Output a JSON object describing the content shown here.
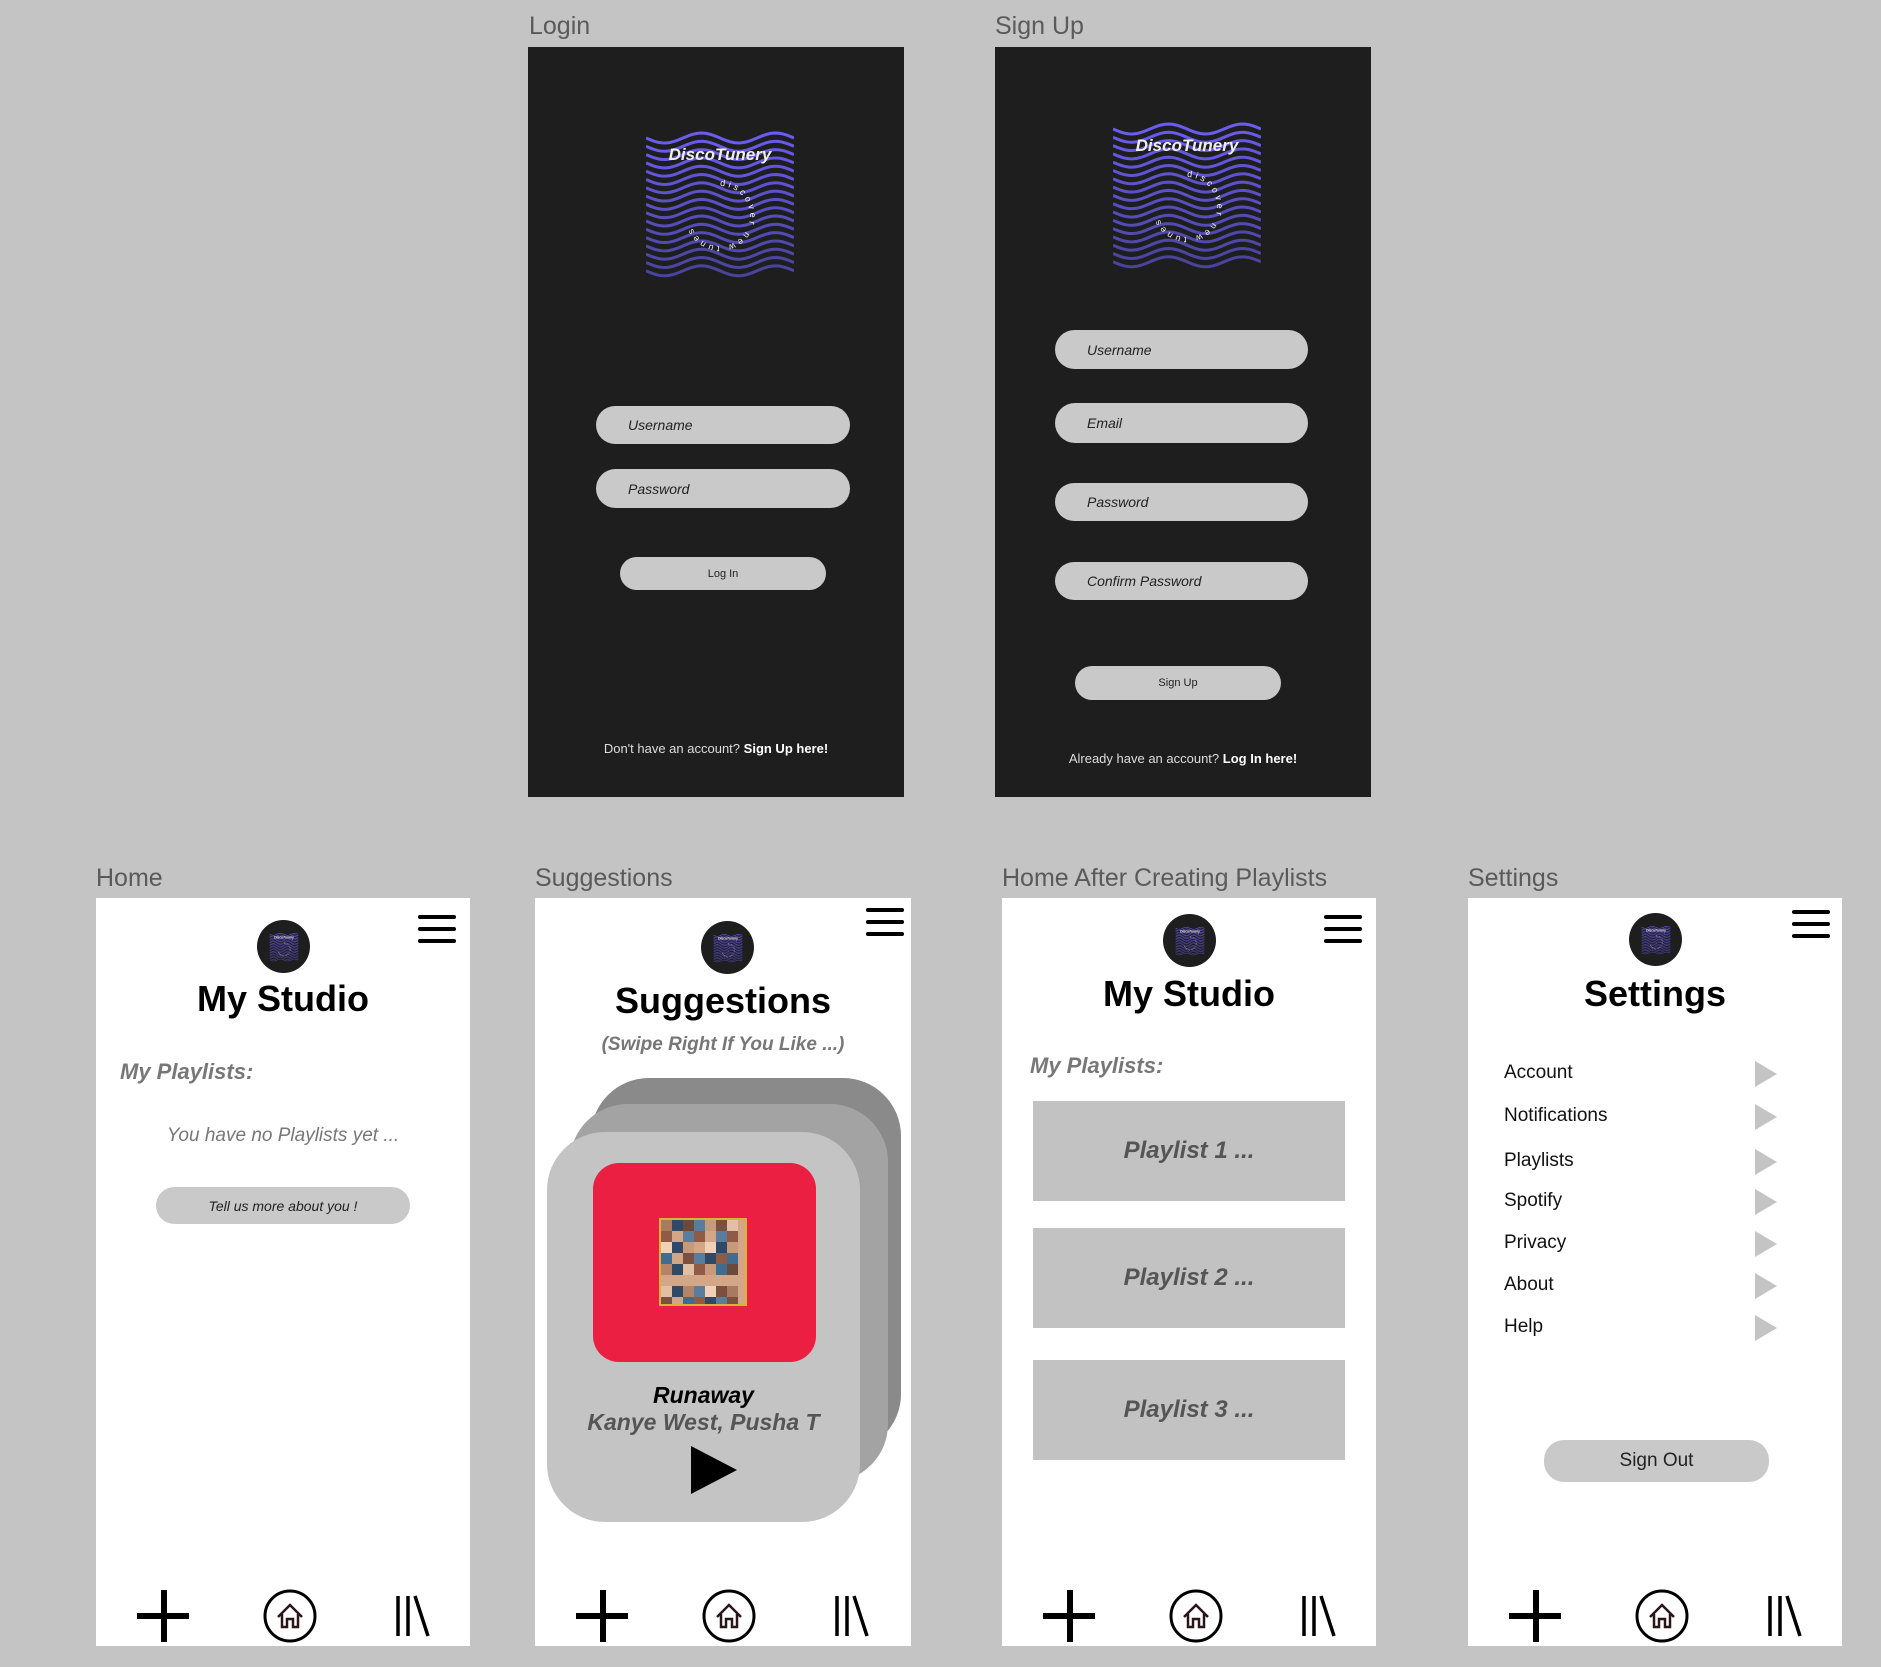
{
  "logo": {
    "name": "DiscoTunery",
    "tagline": "discover new tunes",
    "color": "#6b5cf0"
  },
  "login": {
    "label": "Login",
    "username_placeholder": "Username",
    "password_placeholder": "Password",
    "login_button": "Log In",
    "footer_text": "Don't have an account?",
    "footer_link": "Sign Up here!"
  },
  "signup": {
    "label": "Sign Up",
    "username_placeholder": "Username",
    "email_placeholder": "Email",
    "password_placeholder": "Password",
    "confirm_placeholder": "Confirm Password",
    "signup_button": "Sign Up",
    "footer_text": "Already have an account?",
    "footer_link": "Log In here!"
  },
  "home": {
    "label": "Home",
    "title": "My Studio",
    "playlists_heading": "My Playlists:",
    "empty_text": "You have no Playlists yet ...",
    "cta_button": "Tell us more about you !"
  },
  "suggestions": {
    "label": "Suggestions",
    "title": "Suggestions",
    "subtitle": "(Swipe Right If You Like ...)",
    "song": "Runaway",
    "artist": "Kanye West, Pusha T",
    "album_color": "#ea1f42"
  },
  "home_after": {
    "label": "Home After Creating Playlists",
    "title": "My Studio",
    "playlists_heading": "My Playlists:",
    "playlists": [
      "Playlist 1 ...",
      "Playlist 2 ...",
      "Playlist 3 ..."
    ]
  },
  "settings": {
    "label": "Settings",
    "title": "Settings",
    "items": [
      "Account",
      "Notifications",
      "Playlists",
      "Spotify",
      "Privacy",
      "About",
      "Help"
    ],
    "sign_out": "Sign Out"
  },
  "nav_icons": [
    "plus-icon",
    "home-icon",
    "library-icon"
  ]
}
